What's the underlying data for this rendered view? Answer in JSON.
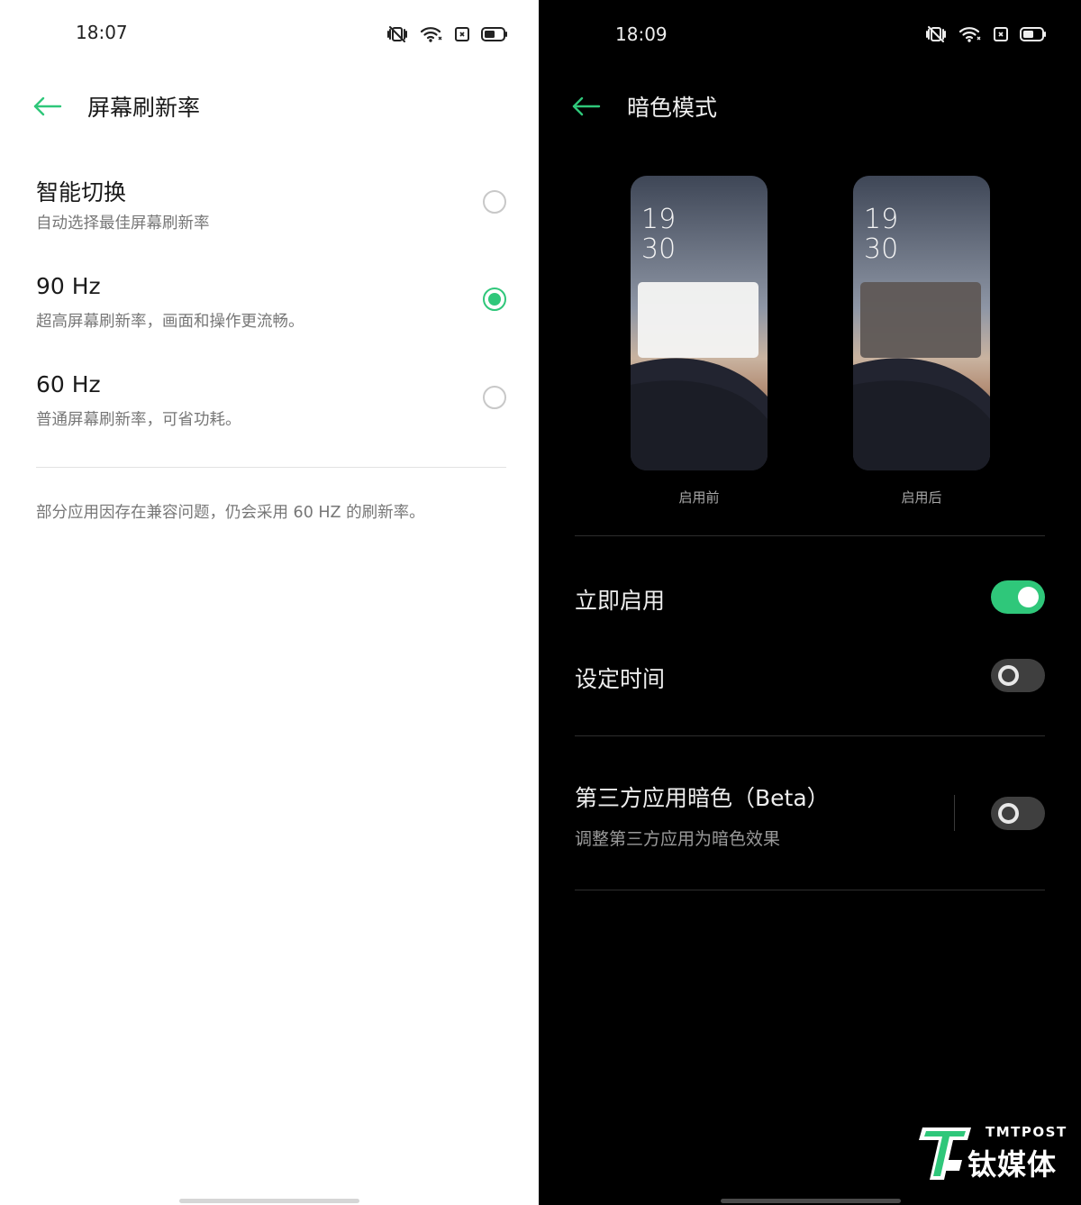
{
  "left_screen": {
    "status": {
      "time": "18:07"
    },
    "header": {
      "title": "屏幕刷新率"
    },
    "options": [
      {
        "title": "智能切换",
        "subtitle": "自动选择最佳屏幕刷新率",
        "selected": false
      },
      {
        "title": "90 Hz",
        "subtitle": "超高屏幕刷新率，画面和操作更流畅。",
        "selected": true
      },
      {
        "title": "60 Hz",
        "subtitle": "普通屏幕刷新率，可省功耗。",
        "selected": false
      }
    ],
    "note": "部分应用因存在兼容问题，仍会采用 60 HZ 的刷新率。"
  },
  "right_screen": {
    "status": {
      "time": "18:09"
    },
    "header": {
      "title": "暗色模式"
    },
    "previews": [
      {
        "clock_hour": "19",
        "clock_minute": "30",
        "caption": "启用前"
      },
      {
        "clock_hour": "19",
        "clock_minute": "30",
        "caption": "启用后"
      }
    ],
    "settings": [
      {
        "label": "立即启用",
        "enabled": true
      },
      {
        "label": "设定时间",
        "enabled": false
      },
      {
        "label": "第三方应用暗色（Beta）",
        "subtitle": "调整第三方应用为暗色效果",
        "enabled": false
      }
    ]
  },
  "watermark": {
    "en": "TMTPOST",
    "cn": "钛媒体"
  },
  "colors": {
    "accent": "#2fc77a",
    "light_bg": "#ffffff",
    "dark_bg": "#000000"
  },
  "icons": [
    "back-arrow-icon",
    "vibrate-mute-icon",
    "wifi-icon",
    "sim-icon",
    "battery-icon"
  ]
}
